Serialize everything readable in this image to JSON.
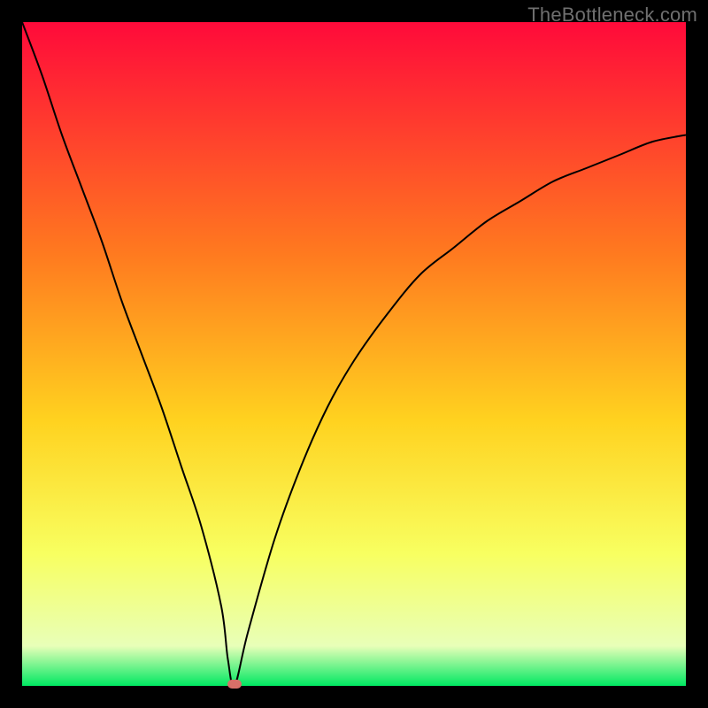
{
  "watermark": "TheBottleneck.com",
  "colors": {
    "black": "#000000",
    "marker": "#d97068",
    "curve": "#000000",
    "grad_top": "#ff0a3a",
    "grad_mid1": "#ff7a1f",
    "grad_mid2": "#ffd21f",
    "grad_mid3": "#f8ff60",
    "grad_mid4": "#e8ffb8",
    "grad_bottom": "#00e862"
  },
  "chart_data": {
    "type": "line",
    "title": "",
    "xlabel": "",
    "ylabel": "",
    "xlim": [
      0,
      100
    ],
    "ylim": [
      0,
      100
    ],
    "grid": false,
    "legend": false,
    "annotations": [
      "TheBottleneck.com"
    ],
    "x": [
      0,
      3,
      6,
      9,
      12,
      15,
      18,
      21,
      24,
      27,
      30,
      31,
      32,
      34,
      38,
      42,
      46,
      50,
      55,
      60,
      65,
      70,
      75,
      80,
      85,
      90,
      95,
      100
    ],
    "values": [
      100,
      92,
      83,
      75,
      67,
      58,
      50,
      42,
      33,
      24,
      12,
      4,
      0,
      8,
      22,
      33,
      42,
      49,
      56,
      62,
      66,
      70,
      73,
      76,
      78,
      80,
      82,
      83
    ],
    "marker": {
      "x": 32,
      "y": 0,
      "color": "#d97068"
    },
    "background_gradient_stops": [
      {
        "pos": 0.0,
        "color": "#ff0a3a"
      },
      {
        "pos": 0.35,
        "color": "#ff7a1f"
      },
      {
        "pos": 0.6,
        "color": "#ffd21f"
      },
      {
        "pos": 0.8,
        "color": "#f8ff60"
      },
      {
        "pos": 0.94,
        "color": "#e8ffb8"
      },
      {
        "pos": 1.0,
        "color": "#00e862"
      }
    ]
  }
}
